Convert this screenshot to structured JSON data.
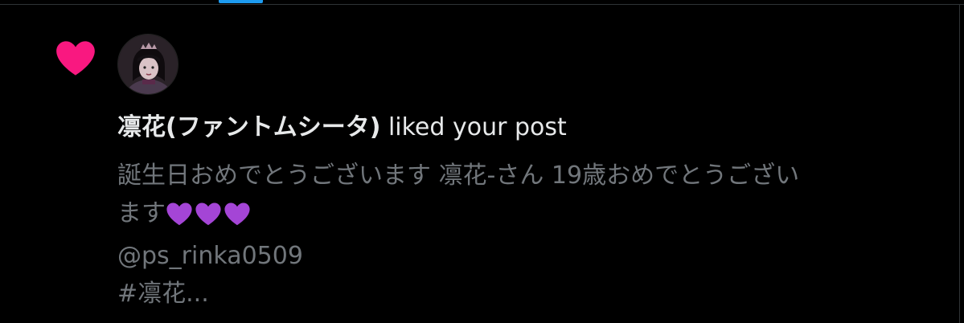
{
  "notification": {
    "actor_name": "凛花(ファントムシータ)",
    "action_text": " liked your post",
    "post_lines": [
      "誕生日おめでとうございます 凛花-さん 19歳おめでとうござい",
      "ます",
      "@ps_rinka0509",
      "#凛花..."
    ],
    "emoji": "💜💜💜"
  },
  "icons": {
    "like": "heart-icon",
    "emoji_heart": "purple-heart-icon"
  },
  "colors": {
    "background": "#000000",
    "like_heart": "#f91880",
    "primary_text": "#e7e9ea",
    "secondary_text": "#71767b",
    "tab_indicator": "#1d9bf0",
    "purple_heart": "#a445d6"
  }
}
